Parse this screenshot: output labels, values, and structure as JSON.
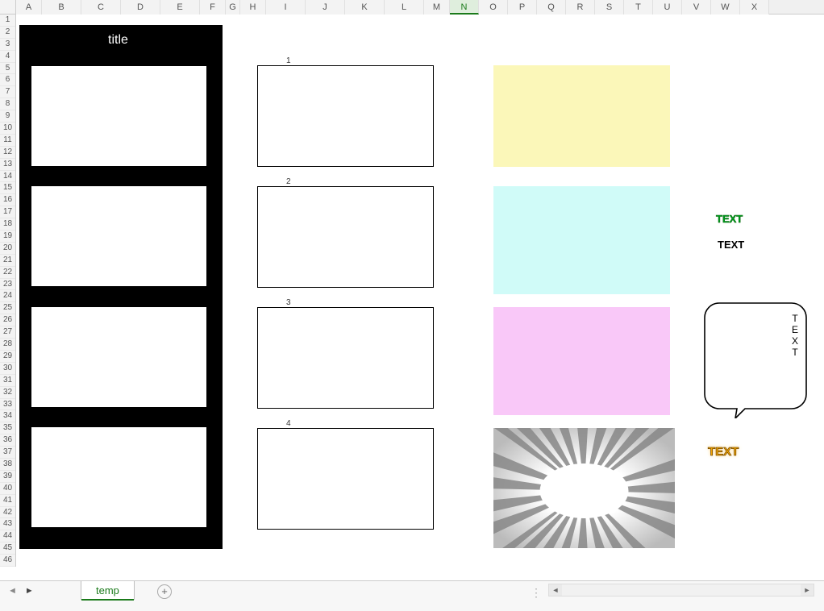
{
  "columns": [
    "A",
    "B",
    "C",
    "D",
    "E",
    "F",
    "G",
    "H",
    "I",
    "J",
    "K",
    "L",
    "M",
    "N",
    "O",
    "P",
    "Q",
    "R",
    "S",
    "T",
    "U",
    "V",
    "W",
    "X"
  ],
  "selected_column": "N",
  "row_count": 46,
  "title": "title",
  "panel_numbers": [
    "1",
    "2",
    "3",
    "4"
  ],
  "color_boxes": [
    {
      "color": "#fbf7b9"
    },
    {
      "color": "#d0fbf8"
    },
    {
      "color": "#f9c8f8"
    }
  ],
  "wordart": {
    "green": "TEXT",
    "black": "TEXT",
    "bubble_vertical": "TEXT",
    "orange": "TEXT"
  },
  "sheet_tab": "temp",
  "add_sheet_label": "+"
}
